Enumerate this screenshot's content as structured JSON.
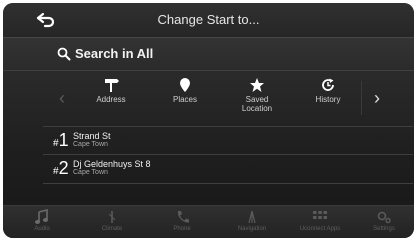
{
  "header": {
    "title": "Change Start to..."
  },
  "search": {
    "label": "Search in All"
  },
  "categories": [
    {
      "label": "Address",
      "icon": "signpost-icon"
    },
    {
      "label": "Places",
      "icon": "map-pin-icon"
    },
    {
      "label": "Saved Location",
      "icon": "star-icon"
    },
    {
      "label": "History",
      "icon": "history-icon"
    }
  ],
  "results": [
    {
      "num": "1",
      "name": "Strand St",
      "city": "Cape Town"
    },
    {
      "num": "2",
      "name": "Dj Geldenhuys St 8",
      "city": "Cape Town"
    }
  ],
  "nav": [
    {
      "label": "Audio",
      "icon": "music-note-icon"
    },
    {
      "label": "Climate",
      "icon": "climate-icon"
    },
    {
      "label": "Phone",
      "icon": "phone-icon"
    },
    {
      "label": "Navigation",
      "icon": "navigation-icon"
    },
    {
      "label": "Uconnect Apps",
      "icon": "apps-grid-icon"
    },
    {
      "label": "Settings",
      "icon": "settings-icon"
    }
  ],
  "colors": {
    "background": "#1f1f1f",
    "text": "#f2f2f2",
    "muted": "#5e5e5e"
  }
}
